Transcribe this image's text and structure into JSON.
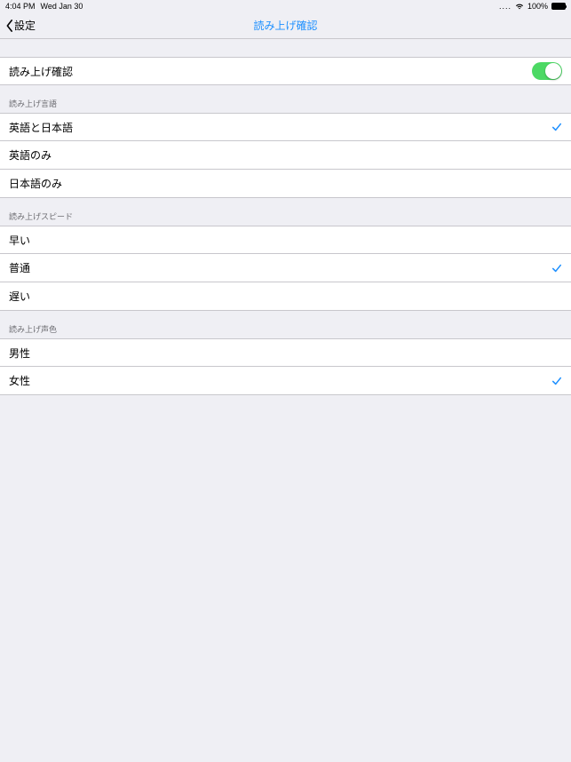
{
  "status": {
    "time": "4:04 PM",
    "date": "Wed Jan 30",
    "battery_pct": "100%"
  },
  "nav": {
    "back_label": "設定",
    "title": "読み上げ確認"
  },
  "toggle_row": {
    "label": "読み上げ確認",
    "on": true
  },
  "sections": {
    "language": {
      "header": "読み上げ言語",
      "options": [
        {
          "label": "英語と日本語",
          "selected": true
        },
        {
          "label": "英語のみ",
          "selected": false
        },
        {
          "label": "日本語のみ",
          "selected": false
        }
      ]
    },
    "speed": {
      "header": "読み上げスピード",
      "options": [
        {
          "label": "早い",
          "selected": false
        },
        {
          "label": "普通",
          "selected": true
        },
        {
          "label": "遅い",
          "selected": false
        }
      ]
    },
    "voice": {
      "header": "読み上げ声色",
      "options": [
        {
          "label": "男性",
          "selected": false
        },
        {
          "label": "女性",
          "selected": true
        }
      ]
    }
  },
  "colors": {
    "accent": "#1e90ff",
    "toggle_on": "#4cd964",
    "bg": "#efeff4",
    "separator": "#c8c7cc"
  }
}
